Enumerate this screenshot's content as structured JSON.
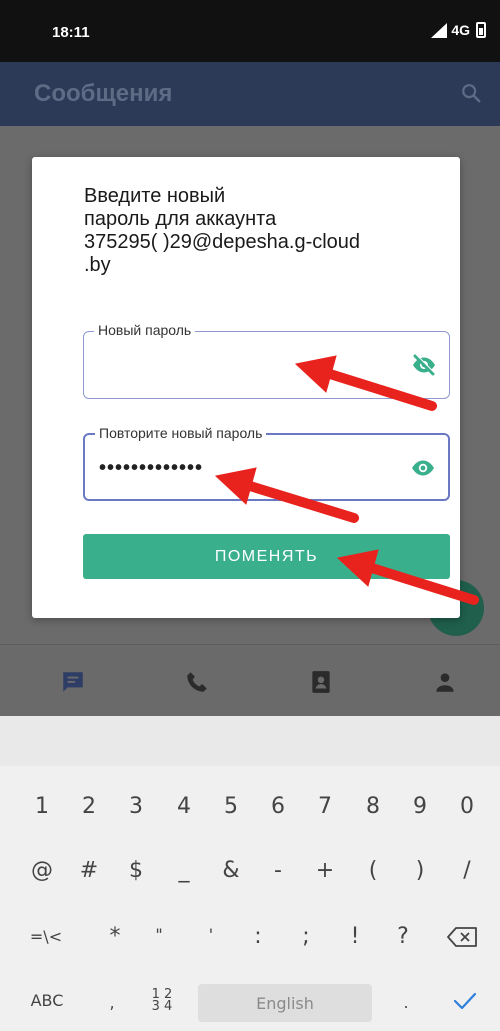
{
  "status_bar": {
    "time": "18:11",
    "network": "4G"
  },
  "app_bar": {
    "title": "Сообщения",
    "search_icon": "search-icon"
  },
  "bottom_nav": {
    "items": [
      "chat-icon",
      "phone-icon",
      "contacts-icon",
      "person-icon"
    ]
  },
  "dialog": {
    "message": "Введите новый\nпароль для аккаунта\n375295(      )29@depesha.g-cloud\n.by",
    "new_password": {
      "label": "Новый пароль",
      "value": "",
      "icon": "eye-off-icon"
    },
    "repeat_password": {
      "label": "Повторите новый пароль",
      "value": "•••••••••••••",
      "icon": "eye-icon"
    },
    "submit_label": "ПОМЕНЯТЬ"
  },
  "keyboard": {
    "row1": [
      "1",
      "2",
      "3",
      "4",
      "5",
      "6",
      "7",
      "8",
      "9",
      "0"
    ],
    "row2": [
      "@",
      "#",
      "$",
      "_",
      "&",
      "-",
      "+",
      "(",
      ")",
      "/"
    ],
    "row3": [
      "=\\<",
      "*",
      "\"",
      "'",
      ":",
      ";",
      "!",
      "?"
    ],
    "abc_label": "ABC",
    "comma_label": ",",
    "numpad_label": "1 2\n3 4",
    "space_label": "English",
    "period_label": ".",
    "enter_icon": "checkmark-icon",
    "backspace_icon": "backspace-icon"
  },
  "colors": {
    "accent": "#3aaf8c",
    "field_border": "#8f99cf",
    "arrow": "#e8231e"
  }
}
